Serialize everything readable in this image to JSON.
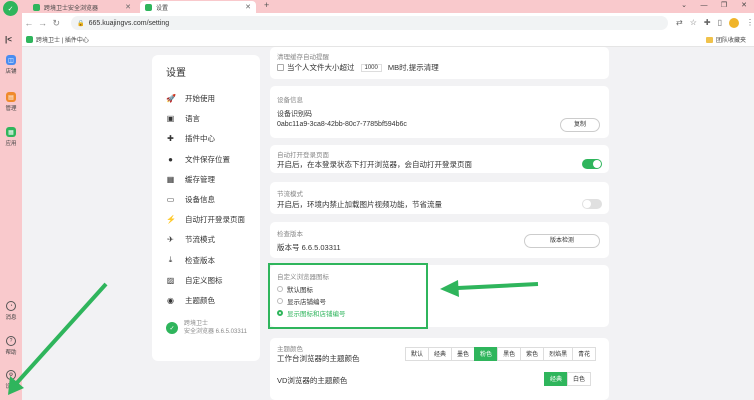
{
  "browser": {
    "tabs": [
      {
        "label": "跨境卫士安全浏览器"
      },
      {
        "label": "设置"
      }
    ],
    "new_tab": "+",
    "url": "665.kuajingvs.com/setting",
    "bookmarks": {
      "left": "跨境卫士 | 插件中心",
      "right": "团队收藏夹"
    }
  },
  "rail": {
    "items": [
      {
        "label": "店铺",
        "color": "#4a8cf0"
      },
      {
        "label": "管理",
        "color": "#f08a2c"
      },
      {
        "label": "应用",
        "color": "#2fb55c"
      }
    ],
    "bottom": [
      {
        "label": "消息"
      },
      {
        "label": "帮助"
      },
      {
        "label": "设置"
      }
    ]
  },
  "settings": {
    "title": "设置",
    "menu": [
      {
        "label": "开始使用",
        "icon": "rocket-icon",
        "glyph": "🚀"
      },
      {
        "label": "语言",
        "icon": "language-icon",
        "glyph": "▣"
      },
      {
        "label": "插件中心",
        "icon": "puzzle-icon",
        "glyph": "✚"
      },
      {
        "label": "文件保存位置",
        "icon": "folder-icon",
        "glyph": "●"
      },
      {
        "label": "缓存管理",
        "icon": "cache-icon",
        "glyph": "▦"
      },
      {
        "label": "设备信息",
        "icon": "monitor-icon",
        "glyph": "▭"
      },
      {
        "label": "自动打开登录页面",
        "icon": "bolt-icon",
        "glyph": "⚡"
      },
      {
        "label": "节流模式",
        "icon": "plane-icon",
        "glyph": "✈"
      },
      {
        "label": "检查版本",
        "icon": "download-icon",
        "glyph": "⤓"
      },
      {
        "label": "自定义图标",
        "icon": "image-icon",
        "glyph": "▨"
      },
      {
        "label": "主题颜色",
        "icon": "palette-icon",
        "glyph": "◉"
      }
    ],
    "brand_name": "跨境卫士",
    "brand_version": "安全浏览器 6.6.5.03311"
  },
  "cache_card": {
    "label": "清理缓存自动提醒",
    "text_before": "当个人文件大小超过",
    "value": "1000",
    "text_after": "MB时,提示清理"
  },
  "device_card": {
    "label": "设备信息",
    "sub_label": "设备识别码",
    "device_id": "0abc11a9-3ca8-42bb-80c7-7785bf594b6c",
    "copy_label": "复制"
  },
  "auto_login_card": {
    "label": "自动打开登录页面",
    "text": "开启后，在本登录状态下打开浏览器，会自动打开登录页面",
    "enabled": true
  },
  "throttle_card": {
    "label": "节流模式",
    "text": "开启后，环境内禁止加载图片视频功能，节省流量",
    "enabled": false
  },
  "version_card": {
    "label": "检查版本",
    "text": "版本号 6.6.5.03311",
    "button": "版本检测"
  },
  "icon_card": {
    "label": "自定义浏览器图标",
    "options": [
      {
        "label": "默认图标",
        "selected": false
      },
      {
        "label": "显示店铺编号",
        "selected": false
      },
      {
        "label": "显示图标和店铺编号",
        "selected": true
      }
    ]
  },
  "theme_card": {
    "label": "主题颜色",
    "workbench_label": "工作台浏览器的主题颜色",
    "workbench_options": [
      "默认",
      "经典",
      "墨色",
      "粉色",
      "黑色",
      "紫色",
      "烈焰黑",
      "青花"
    ],
    "workbench_selected": "粉色",
    "vd_label": "VD浏览器的主题颜色",
    "vd_options": [
      "经典",
      "白色"
    ],
    "vd_selected": "经典"
  },
  "colors": {
    "accent": "#2fb55c",
    "chrome": "#f9c9cc"
  }
}
